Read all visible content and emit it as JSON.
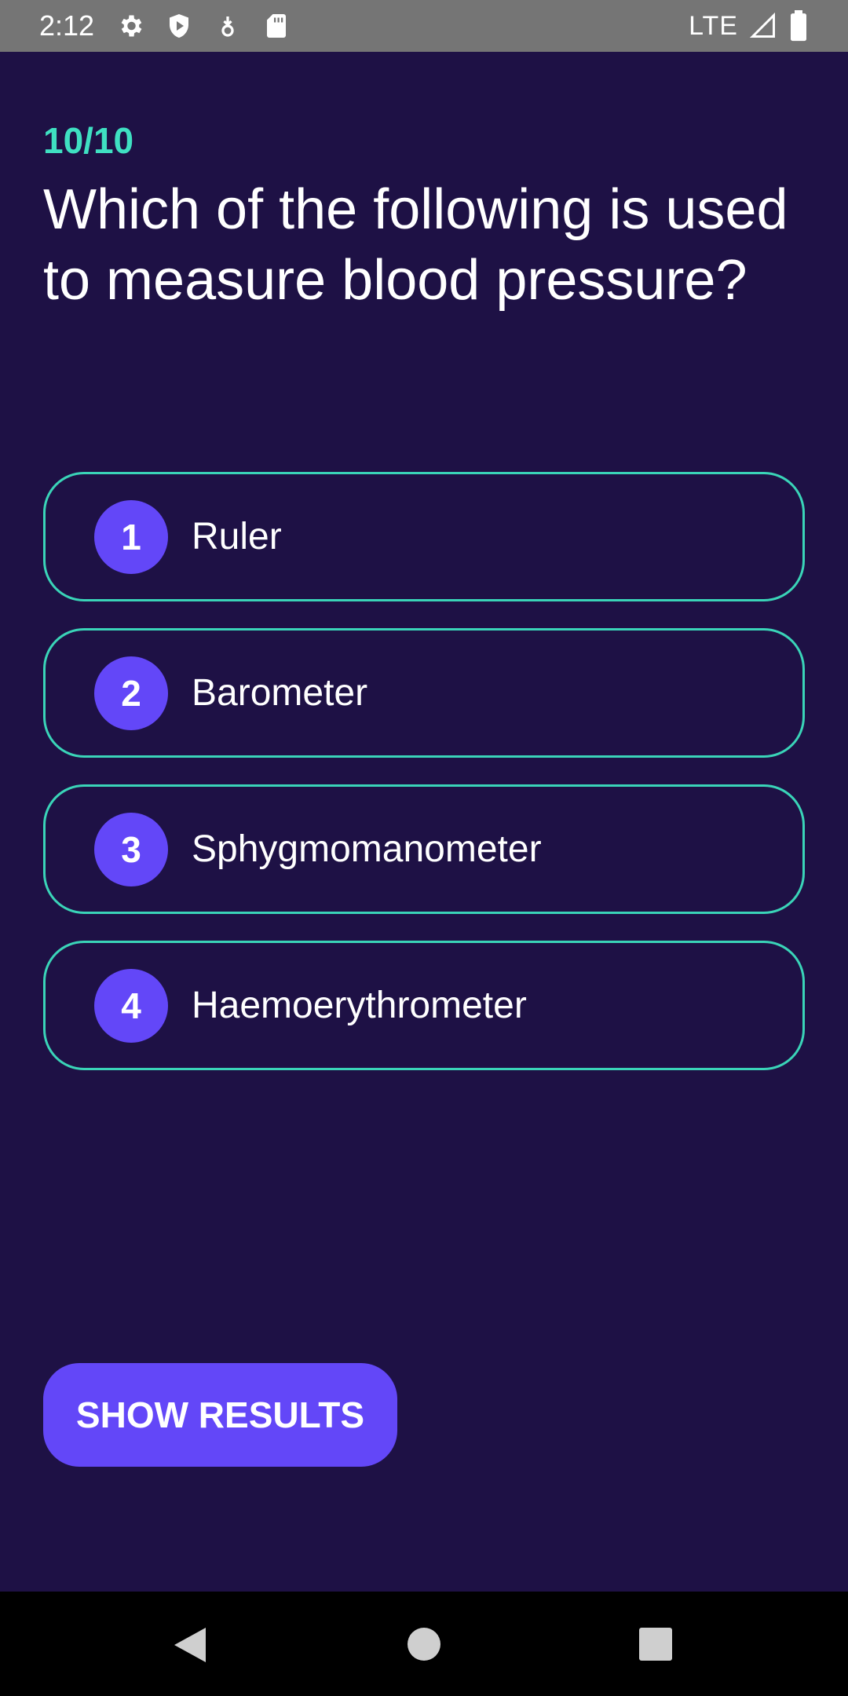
{
  "status_bar": {
    "time": "2:12",
    "network": "LTE",
    "icons": [
      "gear-icon",
      "shield-play-icon",
      "download-icon",
      "sd-card-icon",
      "signal-icon",
      "battery-icon"
    ]
  },
  "quiz": {
    "progress": "10/10",
    "question": "Which of the following is used to measure blood pressure?",
    "answers": [
      {
        "number": "1",
        "label": "Ruler"
      },
      {
        "number": "2",
        "label": "Barometer"
      },
      {
        "number": "3",
        "label": "Sphygmomanometer"
      },
      {
        "number": "4",
        "label": "Haemoerythrometer"
      }
    ]
  },
  "actions": {
    "show_results_label": "SHOW RESULTS"
  },
  "nav_bar": {
    "icons": [
      "back-icon",
      "home-icon",
      "recents-icon"
    ]
  },
  "colors": {
    "background": "#1e1145",
    "accent": "#6347f8",
    "teal": "#3ad4b8",
    "progress_text": "#3fe0c2"
  }
}
